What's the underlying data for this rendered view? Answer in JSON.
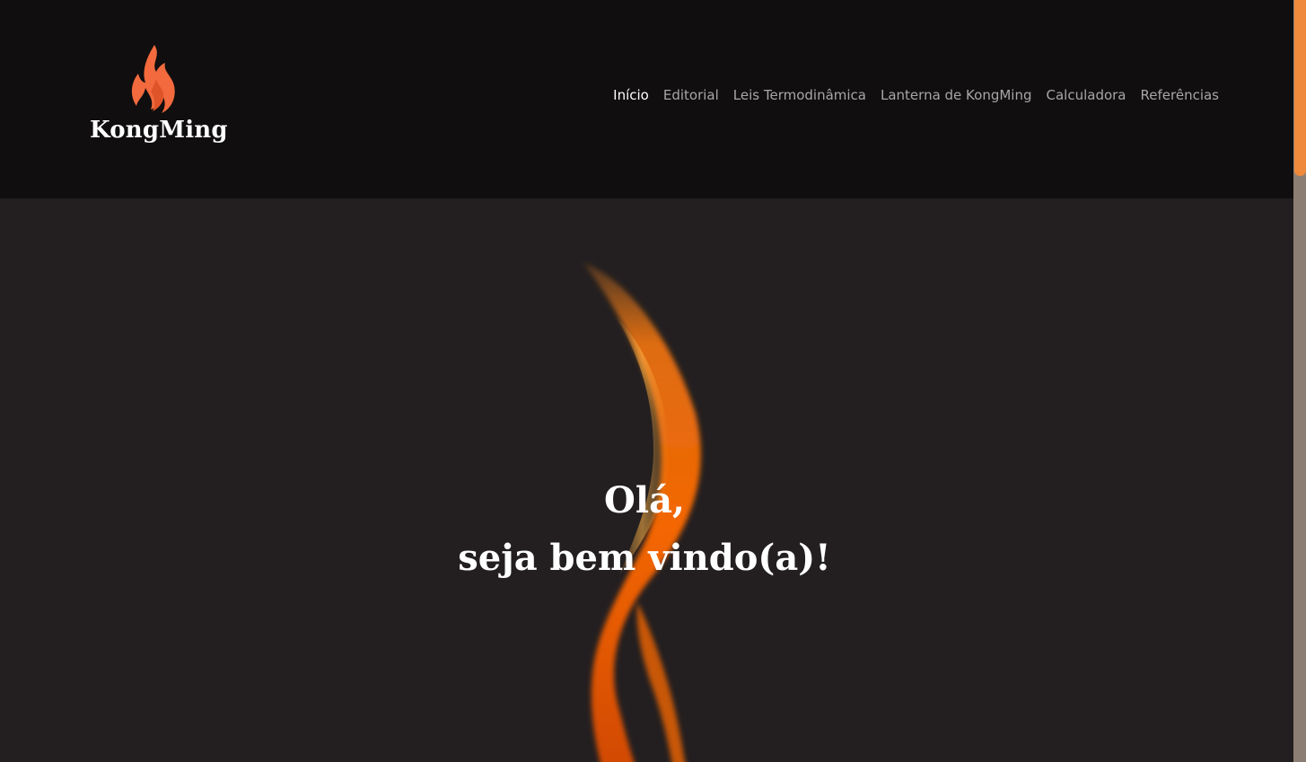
{
  "brand": {
    "name": "KongMing",
    "flame_color": "#f26a3d"
  },
  "nav": {
    "items": [
      {
        "label": "Início",
        "active": true
      },
      {
        "label": "Editorial",
        "active": false
      },
      {
        "label": "Leis Termodinâmica",
        "active": false
      },
      {
        "label": "Lanterna de KongMing",
        "active": false
      },
      {
        "label": "Calculadora",
        "active": false
      },
      {
        "label": "Referências",
        "active": false
      }
    ]
  },
  "hero": {
    "line1": "Olá,",
    "line2": "seja bem vindo(a)!",
    "flame_color": "#ff7a10"
  },
  "colors": {
    "header_bg": "#100e0f",
    "hero_bg": "#231f20",
    "nav_text": "#a9a6a7",
    "nav_active": "#ffffff",
    "scroll_thumb": "#ef8a3c"
  }
}
